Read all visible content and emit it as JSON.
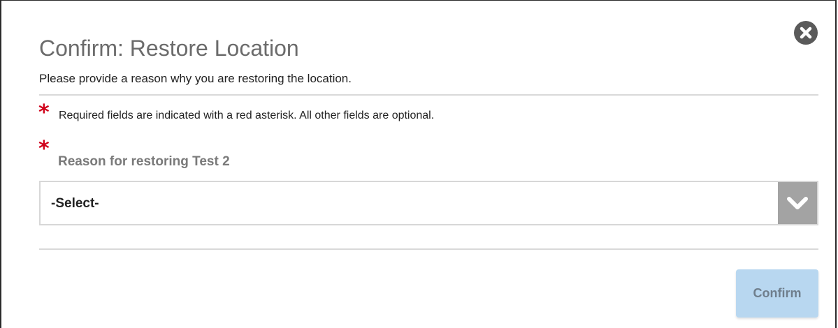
{
  "dialog": {
    "title": "Confirm: Restore Location",
    "subtitle": "Please provide a reason why you are restoring the location.",
    "required_note": "Required fields are indicated with a red asterisk. All other fields are optional.",
    "required_marker": "*",
    "close_icon": "close-circle-icon"
  },
  "reason_field": {
    "label": "Reason for restoring Test 2",
    "selected_value": "-Select-",
    "arrow_icon": "chevron-down-icon"
  },
  "actions": {
    "confirm_label": "Confirm",
    "confirm_state": "disabled"
  },
  "colors": {
    "asterisk": "#d0021b",
    "title": "#6b6b6b",
    "confirm_bg": "#b8d7f0",
    "select_arrow_bg": "#a3a3a3"
  }
}
